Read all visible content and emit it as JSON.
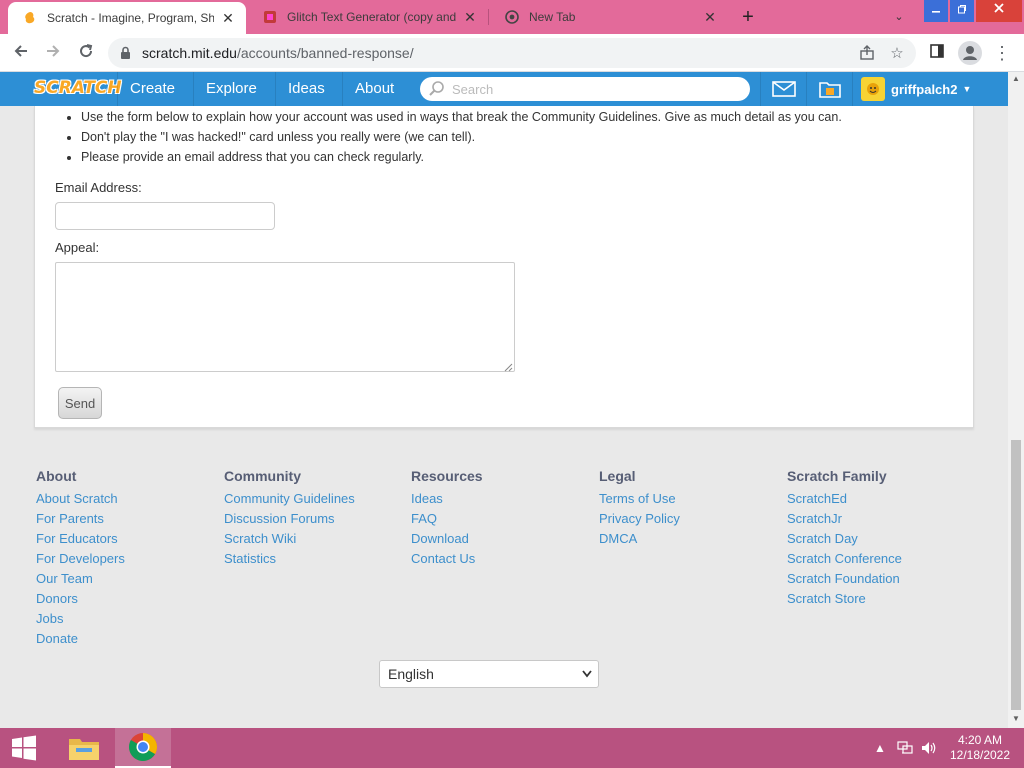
{
  "browser": {
    "tabs": [
      {
        "title": "Scratch - Imagine, Program, Shar",
        "active": true
      },
      {
        "title": "Glitch Text Generator (copy and",
        "active": false
      },
      {
        "title": "New Tab",
        "active": false
      }
    ],
    "url_host": "scratch.mit.edu",
    "url_path": "/accounts/banned-response/"
  },
  "nav": {
    "logo": "SCRATCH",
    "links": [
      "Create",
      "Explore",
      "Ideas",
      "About"
    ],
    "search_placeholder": "Search",
    "username": "griffpalch2"
  },
  "form": {
    "bullets": [
      "Use the form below to explain how your account was used in ways that break the Community Guidelines. Give as much detail as you can.",
      "Don't play the \"I was hacked!\" card unless you really were (we can tell).",
      "Please provide an email address that you can check regularly."
    ],
    "email_label": "Email Address:",
    "email_value": "",
    "appeal_label": "Appeal:",
    "appeal_value": "",
    "send_label": "Send"
  },
  "footer": {
    "columns": [
      {
        "heading": "About",
        "links": [
          "About Scratch",
          "For Parents",
          "For Educators",
          "For Developers",
          "Our Team",
          "Donors",
          "Jobs",
          "Donate"
        ]
      },
      {
        "heading": "Community",
        "links": [
          "Community Guidelines",
          "Discussion Forums",
          "Scratch Wiki",
          "Statistics"
        ]
      },
      {
        "heading": "Resources",
        "links": [
          "Ideas",
          "FAQ",
          "Download",
          "Contact Us"
        ]
      },
      {
        "heading": "Legal",
        "links": [
          "Terms of Use",
          "Privacy Policy",
          "DMCA"
        ]
      },
      {
        "heading": "Scratch Family",
        "links": [
          "ScratchEd",
          "ScratchJr",
          "Scratch Day",
          "Scratch Conference",
          "Scratch Foundation",
          "Scratch Store"
        ]
      }
    ],
    "language": "English"
  },
  "taskbar": {
    "time": "4:20 AM",
    "date": "12/18/2022"
  },
  "colors": {
    "tabstrip": "#e36a9a",
    "scratch_nav": "#2d8fd5",
    "link": "#3d8fcc",
    "taskbar": "#b85280"
  }
}
